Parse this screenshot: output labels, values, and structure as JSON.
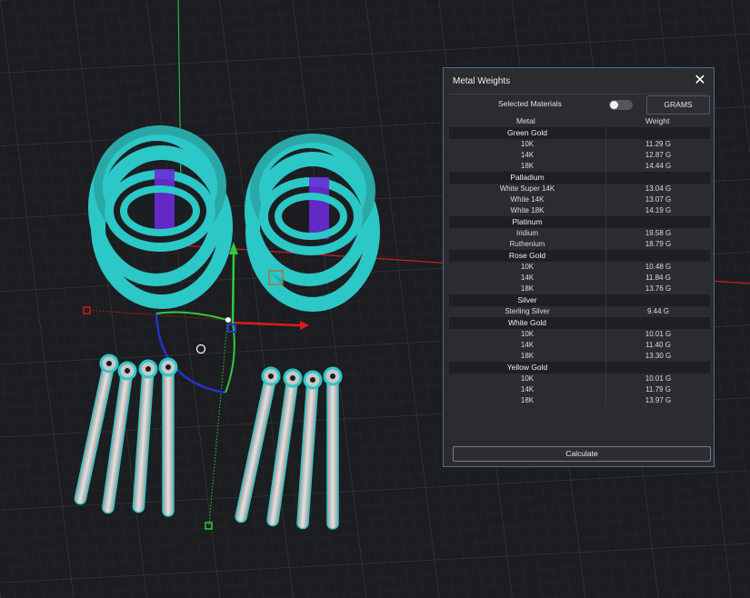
{
  "panel": {
    "title": "Metal Weights",
    "selected_materials_label": "Selected Materials",
    "toggle_on": false,
    "units_button": "GRAMS",
    "col_metal": "Metal",
    "col_weight": "Weight",
    "calculate_label": "Calculate"
  },
  "groups": [
    {
      "name": "Green Gold",
      "items": [
        {
          "name": "10K",
          "weight": "11.29 G"
        },
        {
          "name": "14K",
          "weight": "12.87 G"
        },
        {
          "name": "18K",
          "weight": "14.44 G"
        }
      ]
    },
    {
      "name": "Palladium",
      "items": [
        {
          "name": "White Super 14K",
          "weight": "13.04 G"
        },
        {
          "name": "White 14K",
          "weight": "13.07 G"
        },
        {
          "name": "White 18K",
          "weight": "14.19 G"
        }
      ]
    },
    {
      "name": "Platinum",
      "items": [
        {
          "name": "Iridium",
          "weight": "19.58 G"
        },
        {
          "name": "Ruthenium",
          "weight": "18.79 G"
        }
      ]
    },
    {
      "name": "Rose Gold",
      "items": [
        {
          "name": "10K",
          "weight": "10.48 G"
        },
        {
          "name": "14K",
          "weight": "11.84 G"
        },
        {
          "name": "18K",
          "weight": "13.76 G"
        }
      ]
    },
    {
      "name": "Silver",
      "items": [
        {
          "name": "Sterling Silver",
          "weight": "9.44 G"
        }
      ]
    },
    {
      "name": "White Gold",
      "items": [
        {
          "name": "10K",
          "weight": "10.01 G"
        },
        {
          "name": "14K",
          "weight": "11.40 G"
        },
        {
          "name": "18K",
          "weight": "13.30 G"
        }
      ]
    },
    {
      "name": "Yellow Gold",
      "items": [
        {
          "name": "10K",
          "weight": "10.01 G"
        },
        {
          "name": "14K",
          "weight": "11.79 G"
        },
        {
          "name": "18K",
          "weight": "13.97 G"
        }
      ]
    }
  ],
  "colors": {
    "background": "#1c1d20",
    "grid": "#3a3b40",
    "axis_x": "#e01b1b",
    "axis_y": "#2ecc40",
    "model_highlight": "#2cc7c7",
    "model_body": "#c8c8c8",
    "inner_accent": "#6a2bd6",
    "panel_border": "#4a6f93"
  }
}
